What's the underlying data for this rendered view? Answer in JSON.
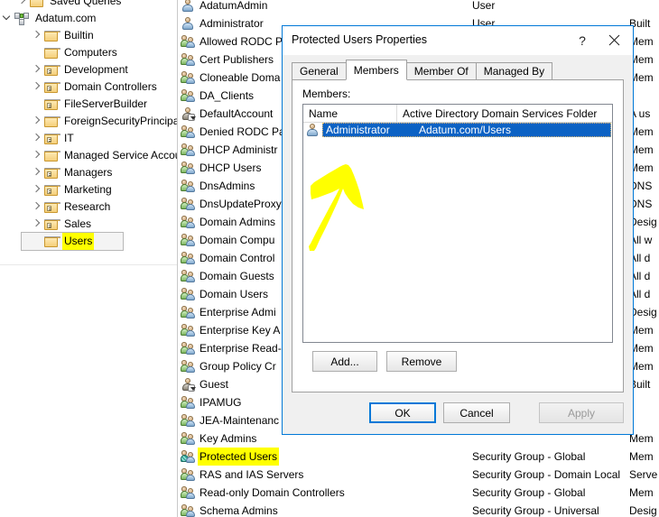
{
  "tree": {
    "items": [
      {
        "label": "Saved Queries",
        "icon": "folder-icon",
        "indent": 1,
        "expander": "collapsed",
        "type": "folder",
        "clipped": true
      },
      {
        "label": "Adatum.com",
        "icon": "domain-icon",
        "indent": 0,
        "expander": "expanded",
        "type": "domain"
      },
      {
        "label": "Builtin",
        "icon": "folder-icon",
        "indent": 2,
        "expander": "collapsed",
        "type": "folder"
      },
      {
        "label": "Computers",
        "icon": "folder-icon",
        "indent": 2,
        "expander": "none",
        "type": "folder"
      },
      {
        "label": "Development",
        "icon": "ou-folder-icon",
        "indent": 2,
        "expander": "collapsed",
        "type": "ou"
      },
      {
        "label": "Domain Controllers",
        "icon": "ou-folder-icon",
        "indent": 2,
        "expander": "collapsed",
        "type": "ou"
      },
      {
        "label": "FileServerBuilder",
        "icon": "ou-folder-icon",
        "indent": 2,
        "expander": "none",
        "type": "ou"
      },
      {
        "label": "ForeignSecurityPrincipals",
        "icon": "folder-icon",
        "indent": 2,
        "expander": "collapsed",
        "type": "folder"
      },
      {
        "label": "IT",
        "icon": "ou-folder-icon",
        "indent": 2,
        "expander": "collapsed",
        "type": "ou"
      },
      {
        "label": "Managed Service Accounts",
        "icon": "folder-icon",
        "indent": 2,
        "expander": "collapsed",
        "type": "folder"
      },
      {
        "label": "Managers",
        "icon": "ou-folder-icon",
        "indent": 2,
        "expander": "collapsed",
        "type": "ou"
      },
      {
        "label": "Marketing",
        "icon": "ou-folder-icon",
        "indent": 2,
        "expander": "collapsed",
        "type": "ou"
      },
      {
        "label": "Research",
        "icon": "ou-folder-icon",
        "indent": 2,
        "expander": "collapsed",
        "type": "ou"
      },
      {
        "label": "Sales",
        "icon": "ou-folder-icon",
        "indent": 2,
        "expander": "collapsed",
        "type": "ou"
      },
      {
        "label": "Users",
        "icon": "folder-icon",
        "indent": 2,
        "expander": "none",
        "type": "folder",
        "highlighted": true,
        "selected": true
      }
    ]
  },
  "list": {
    "rows": [
      {
        "name": "AdatumAdmin",
        "icon": "user-icon",
        "type": "User",
        "description": ""
      },
      {
        "name": "Administrator",
        "icon": "user-icon",
        "type": "User",
        "description": "Built"
      },
      {
        "name": "Allowed RODC P",
        "icon": "group-icon",
        "type": "",
        "description": "Mem"
      },
      {
        "name": "Cert Publishers",
        "icon": "group-icon",
        "type": "",
        "description": "Mem"
      },
      {
        "name": "Cloneable Doma",
        "icon": "group-icon",
        "type": "",
        "description": "Mem"
      },
      {
        "name": "DA_Clients",
        "icon": "group-icon",
        "type": "",
        "description": ""
      },
      {
        "name": "DefaultAccount",
        "icon": "disabled-user-icon",
        "type": "",
        "description": "A us"
      },
      {
        "name": "Denied RODC Pa",
        "icon": "group-icon",
        "type": "",
        "description": "Mem"
      },
      {
        "name": "DHCP Administr",
        "icon": "group-icon",
        "type": "",
        "description": "Mem"
      },
      {
        "name": "DHCP Users",
        "icon": "group-icon",
        "type": "",
        "description": "Mem"
      },
      {
        "name": "DnsAdmins",
        "icon": "group-icon",
        "type": "",
        "description": "DNS"
      },
      {
        "name": "DnsUpdateProxy",
        "icon": "group-icon",
        "type": "",
        "description": "DNS"
      },
      {
        "name": "Domain Admins",
        "icon": "group-icon",
        "type": "",
        "description": "Desig"
      },
      {
        "name": "Domain Compu",
        "icon": "group-icon",
        "type": "",
        "description": "All w"
      },
      {
        "name": "Domain Control",
        "icon": "group-icon",
        "type": "",
        "description": "All d"
      },
      {
        "name": "Domain Guests",
        "icon": "group-icon",
        "type": "",
        "description": "All d"
      },
      {
        "name": "Domain Users",
        "icon": "group-icon",
        "type": "",
        "description": "All d"
      },
      {
        "name": "Enterprise Admi",
        "icon": "group-icon",
        "type": "",
        "description": "Desig"
      },
      {
        "name": "Enterprise Key A",
        "icon": "group-icon",
        "type": "",
        "description": "Mem"
      },
      {
        "name": "Enterprise Read-",
        "icon": "group-icon",
        "type": "",
        "description": "Mem"
      },
      {
        "name": "Group Policy Cr",
        "icon": "group-icon",
        "type": "",
        "description": "Mem"
      },
      {
        "name": "Guest",
        "icon": "disabled-user-icon",
        "type": "",
        "description": "Built"
      },
      {
        "name": "IPAMUG",
        "icon": "group-icon",
        "type": "",
        "description": ""
      },
      {
        "name": "JEA-Maintenanc",
        "icon": "group-icon",
        "type": "",
        "description": ""
      },
      {
        "name": "Key Admins",
        "icon": "group-icon",
        "type": "",
        "description": "Mem"
      },
      {
        "name": "Protected Users",
        "icon": "protected-group-icon",
        "type": "Security Group - Global",
        "description": "Mem",
        "highlighted": true
      },
      {
        "name": "RAS and IAS Servers",
        "icon": "group-icon",
        "type": "Security Group - Domain Local",
        "description": "Serve"
      },
      {
        "name": "Read-only Domain Controllers",
        "icon": "group-icon",
        "type": "Security Group - Global",
        "description": "Mem"
      },
      {
        "name": "Schema Admins",
        "icon": "group-icon",
        "type": "Security Group - Universal",
        "description": "Desig"
      }
    ]
  },
  "dialog": {
    "title": "Protected Users Properties",
    "help_label": "?",
    "close_label": "close-icon",
    "tabs": [
      {
        "label": "General",
        "active": false
      },
      {
        "label": "Members",
        "active": true
      },
      {
        "label": "Member Of",
        "active": false
      },
      {
        "label": "Managed By",
        "active": false
      }
    ],
    "members_label": "Members:",
    "columns": [
      "Name",
      "Active Directory Domain Services Folder"
    ],
    "members": [
      {
        "name": "Administrator",
        "folder": "Adatum.com/Users",
        "icon": "user-icon",
        "selected": true
      }
    ],
    "add_label": "Add...",
    "remove_label": "Remove",
    "ok_label": "OK",
    "cancel_label": "Cancel",
    "apply_label": "Apply",
    "accent_color": "#0078d7",
    "selection_color": "#0b62c4"
  },
  "annotation": {
    "arrow_color": "#ffff00",
    "arrow_name": "yellow-arrow-pointing-up",
    "highlight_color": "#ffff00"
  }
}
